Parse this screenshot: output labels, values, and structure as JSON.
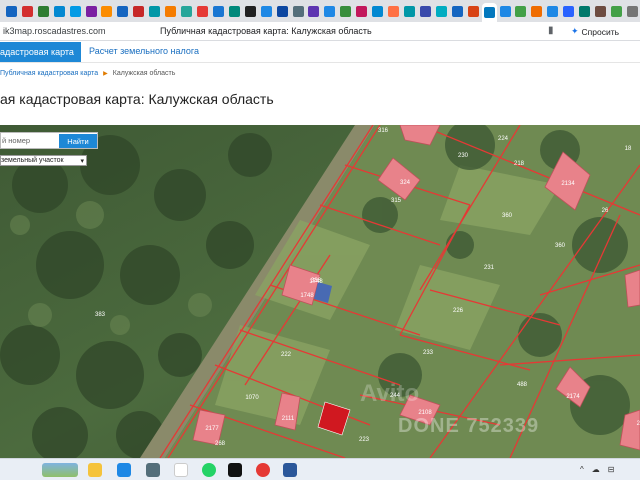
{
  "browser": {
    "url": "ik3map.roscadastres.com",
    "tab_title": "Публичная кадастровая карта: Калужская область",
    "ask_label": "Спросить",
    "bookmark_icon": "bookmark-icon",
    "tab_icon_colors": [
      "#1565c0",
      "#d32f2f",
      "#2e7d32",
      "#0288d1",
      "#039be5",
      "#7b1fa2",
      "#fb8c00",
      "#1565c0",
      "#c62828",
      "#0097a7",
      "#f57c00",
      "#26a69a",
      "#e53935",
      "#1976d2",
      "#00897b",
      "#212121",
      "#1e88e5",
      "#0d47a1",
      "#546e7a",
      "#5e35b1",
      "#1e88e5",
      "#388e3c",
      "#c2185b",
      "#0288d1",
      "#ff7043",
      "#0097a7",
      "#3949ab",
      "#00acc1",
      "#1565c0",
      "#d84315",
      "#0277bd",
      "#1e88e5",
      "#43a047",
      "#ef6c00",
      "#1e88e5",
      "#2962ff",
      "#00796b",
      "#6d4c41",
      "#43a047",
      "#757575"
    ],
    "tab_glyphs": [
      "a",
      "Y",
      "",
      "",
      "",
      "",
      "",
      "",
      "",
      "",
      "Y",
      "",
      "",
      "",
      "",
      "",
      "",
      "",
      "",
      "",
      "",
      "",
      "",
      "",
      "",
      "",
      "",
      "",
      "",
      "",
      "",
      "",
      "",
      "",
      "",
      "",
      "",
      "",
      "",
      ""
    ]
  },
  "nav": {
    "active_tab": "адастровая карта",
    "tab2": "Расчет земельного налога"
  },
  "breadcrumb": {
    "link": "Публичная кадастровая карта",
    "current": "Калужская область"
  },
  "page": {
    "title": "ая кадастровая карта: Калужская область"
  },
  "search": {
    "placeholder": "й номер",
    "button": "Найти"
  },
  "object_type": {
    "selected": "земельный участок"
  },
  "map": {
    "parcel_labels": [
      "316",
      "224",
      "230",
      "218",
      "18",
      "324",
      "315",
      "360",
      "2134",
      "360",
      "231",
      "226",
      "383",
      "1748",
      "336",
      "222",
      "233",
      "488",
      "244",
      "1070",
      "2111",
      "2108",
      "223",
      "26",
      "268",
      "2177",
      "2174",
      "1748",
      "24"
    ],
    "watermark": "Avito",
    "watermark2": "DONE 752339",
    "accent": "#e53935"
  },
  "taskbar": {
    "icons": [
      "windows-widget",
      "explorer",
      "store",
      "calculator",
      "yandex",
      "whatsapp",
      "capcut",
      "shopping",
      "word"
    ],
    "tray": [
      "^",
      "☁",
      "⊟"
    ]
  }
}
